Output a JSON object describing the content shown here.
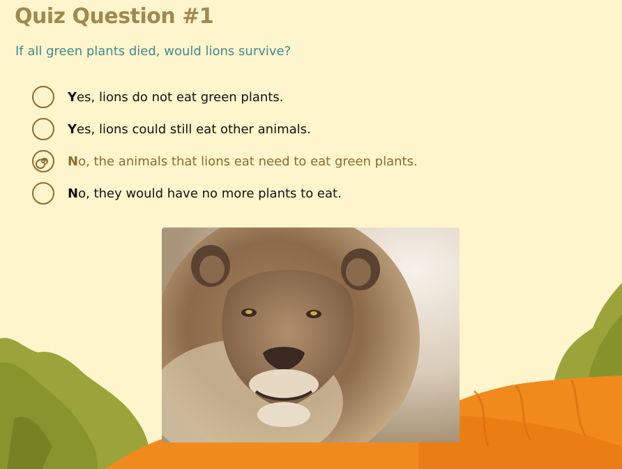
{
  "quiz": {
    "title": "Quiz Question #1",
    "question": "If all green plants died, would lions survive?",
    "options": [
      {
        "label": "Yes, lions do not eat green plants.",
        "selected": false
      },
      {
        "label": "Yes, lions could still eat other animals.",
        "selected": false
      },
      {
        "label": "No, the animals that lions eat need to eat green plants.",
        "selected": true
      },
      {
        "label": "No, they would have no more plants to eat.",
        "selected": false
      }
    ]
  },
  "colors": {
    "background": "#fef5cc",
    "title": "#a08850",
    "question": "#3f8a8e",
    "radio": "#8c6a2c",
    "hill": "#f08a1c",
    "bush": "#8a9a2a"
  },
  "image": {
    "subject": "lion-photo"
  }
}
